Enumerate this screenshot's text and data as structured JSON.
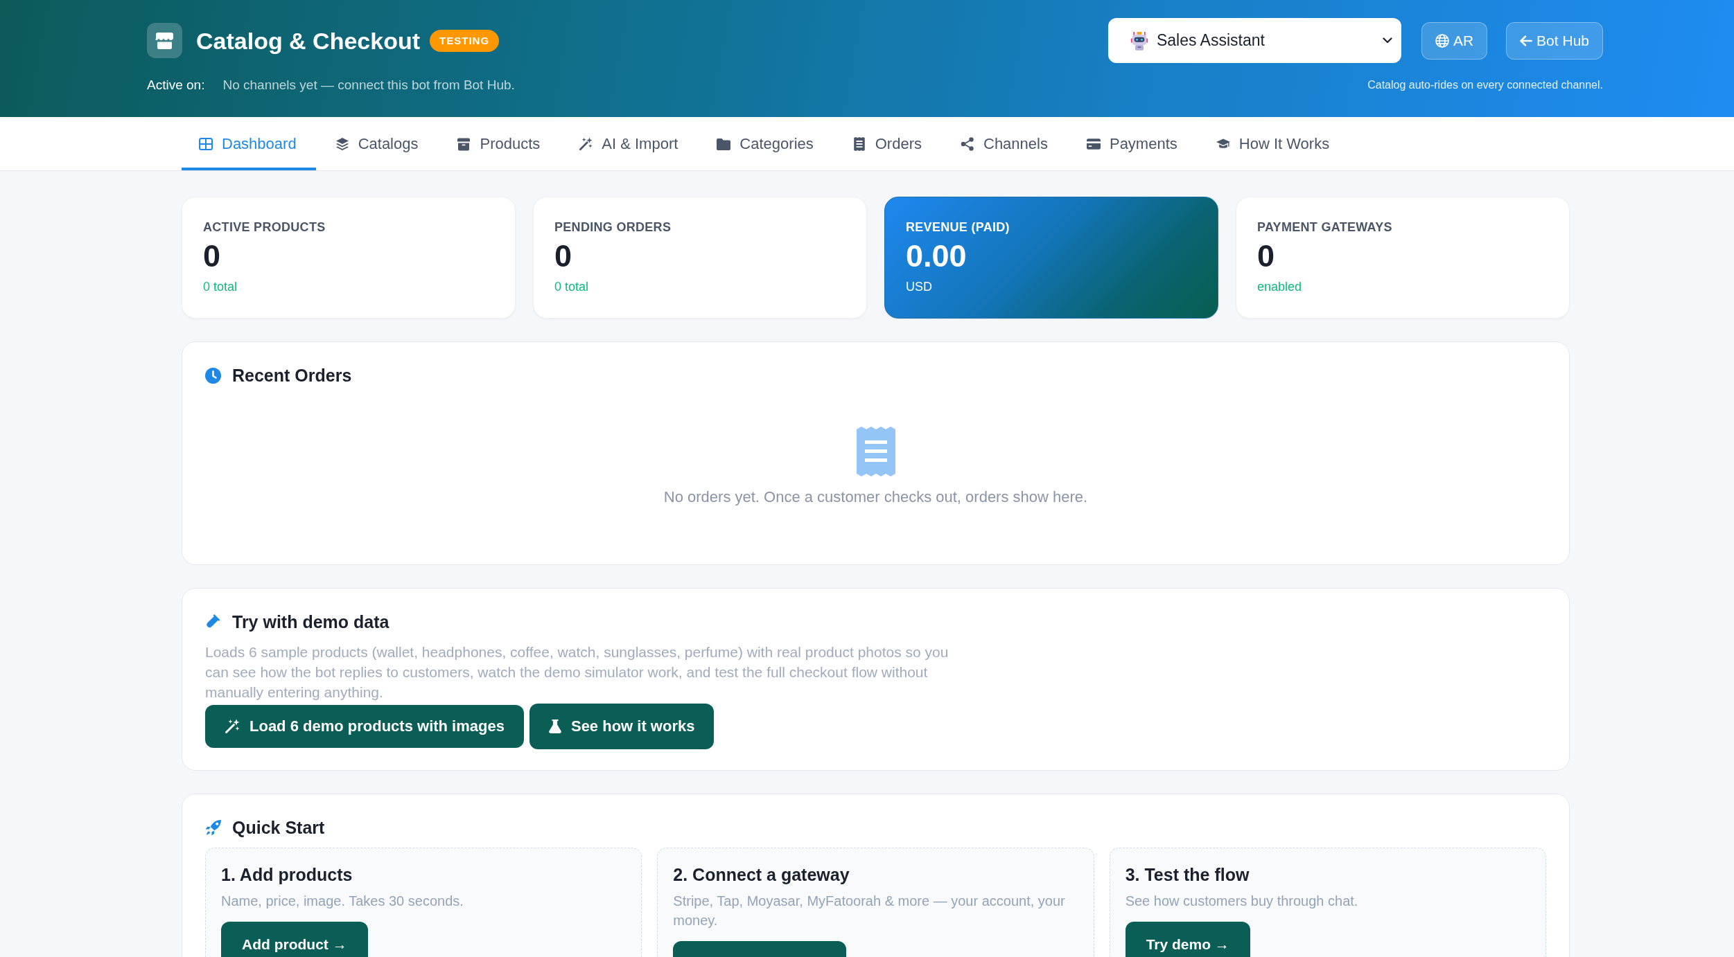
{
  "header": {
    "title": "Catalog & Checkout",
    "badge": "TESTING",
    "active_on_label": "Active on:",
    "active_on_value": "No channels yet — connect this bot from Bot Hub.",
    "bot_select": {
      "value": "Sales Assistant"
    },
    "buttons": [
      {
        "kind": "language",
        "label": "AR"
      },
      {
        "kind": "back",
        "label": "Bot Hub"
      }
    ],
    "note": "Catalog auto-rides on every connected channel."
  },
  "tabs": [
    {
      "label": "Dashboard",
      "selected": true
    },
    {
      "label": "Catalogs",
      "selected": false
    },
    {
      "label": "Products",
      "selected": false
    },
    {
      "label": "AI & Import",
      "selected": false
    },
    {
      "label": "Categories",
      "selected": false
    },
    {
      "label": "Orders",
      "selected": false
    },
    {
      "label": "Channels",
      "selected": false
    },
    {
      "label": "Payments",
      "selected": false
    },
    {
      "label": "How It Works",
      "selected": false
    }
  ],
  "stats": [
    {
      "label": "ACTIVE PRODUCTS",
      "value": "0",
      "caption": "0 total",
      "highlighted": false
    },
    {
      "label": "PENDING ORDERS",
      "value": "0",
      "caption": "0 total",
      "highlighted": false
    },
    {
      "label": "REVENUE (PAID)",
      "value": "0.00",
      "caption": "USD",
      "highlighted": true
    },
    {
      "label": "PAYMENT GATEWAYS",
      "value": "0",
      "caption": "enabled",
      "highlighted": false
    }
  ],
  "recent_orders": {
    "title": "Recent Orders",
    "empty_text": "No orders yet. Once a customer checks out, orders show here."
  },
  "demo": {
    "title": "Try with demo data",
    "description": "Loads 6 sample products (wallet, headphones, coffee, watch, sunglasses, perfume) with real product photos so you can see how the bot replies to customers, watch the demo simulator work, and test the full checkout flow without manually entering anything.",
    "buttons": [
      {
        "kind": "load",
        "label": "Load 6 demo products with images"
      },
      {
        "kind": "simulate",
        "label": "See how it works"
      }
    ]
  },
  "quick_start": {
    "title": "Quick Start",
    "steps": [
      {
        "title": "1. Add products",
        "description": "Name, price, image. Takes 30 seconds.",
        "action": {
          "kind": "button",
          "label": "Add product →"
        }
      },
      {
        "title": "2. Connect a gateway",
        "description": "Stripe, Tap, Moyasar, MyFatoorah & more — your account, your money.",
        "action": {
          "kind": "button"
        }
      },
      {
        "title": "3. Test the flow",
        "description": "See how customers buy through chat.",
        "action": {
          "kind": "button",
          "label": "Try demo →"
        }
      }
    ]
  }
}
